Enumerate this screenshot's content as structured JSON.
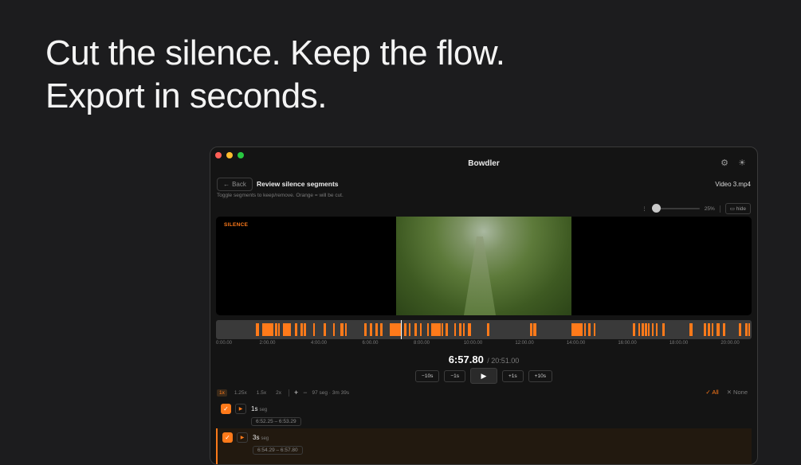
{
  "hero": {
    "line1": "Cut the silence. Keep the flow.",
    "line2": "Export in seconds."
  },
  "window": {
    "title": "Bowdler",
    "traffic_lights": [
      "#ff5f57",
      "#febc2e",
      "#28c840"
    ],
    "settings_icon": "gear-icon",
    "theme_icon": "sun-icon"
  },
  "header": {
    "back_label": "Back",
    "title": "Review silence segments",
    "subtitle": "Toggle segments to keep/remove. Orange = will be cut.",
    "file_name": "Video 3.mp4"
  },
  "zoom": {
    "value": "25%",
    "hide_label": "hide"
  },
  "preview": {
    "badge": "SILENCE"
  },
  "timeline": {
    "tick_labels": [
      "0:00.00",
      "2:00.00",
      "4:00.00",
      "6:00.00",
      "8:00.00",
      "10:00.00",
      "12:00.00",
      "14:00.00",
      "16:00.00",
      "18:00.00",
      "20:00.00"
    ],
    "accent": "#ff7a1a"
  },
  "playback": {
    "current": "6:57.80",
    "total": "/ 20:51.00",
    "back10": "−10s",
    "back1": "−1s",
    "fwd1": "+1s",
    "fwd10": "+10s"
  },
  "toolbar": {
    "speeds": [
      "1x",
      "1.25x",
      "1.5x",
      "2x"
    ],
    "plus": "+",
    "minus": "−",
    "summary": "97 seg · 3m 39s",
    "select_all": "✓ All",
    "select_none": "✕ None"
  },
  "segments": [
    {
      "duration": "1s",
      "unit": "seg",
      "range": "6:52.25 – 6:53.29",
      "checked": true
    },
    {
      "duration": "3s",
      "unit": "seg",
      "range": "6:54.29 – 6:57.80",
      "checked": true
    }
  ]
}
